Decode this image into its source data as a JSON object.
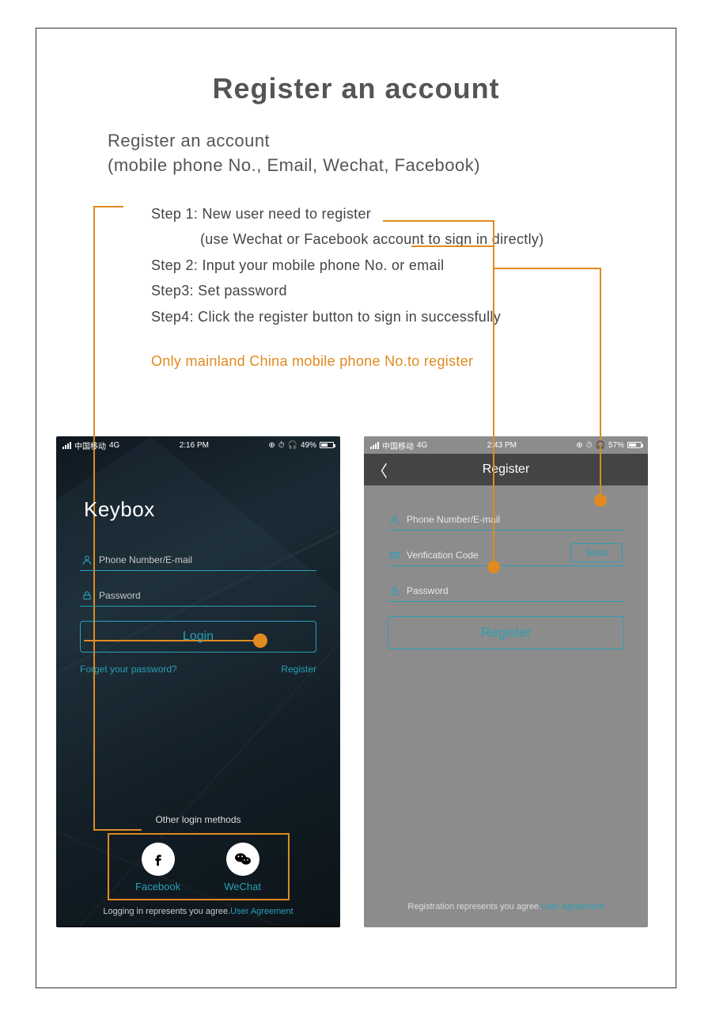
{
  "doc": {
    "title": "Register an account",
    "subtitle_line1": "Register an account",
    "subtitle_line2": "(mobile phone No., Email, Wechat, Facebook)",
    "step1a": "Step 1: New user need to register",
    "step1b": "(use Wechat or Facebook account to sign in directly)",
    "step2": "Step 2: Input your mobile phone No. or email",
    "step3": "Step3: Set password",
    "step4": "Step4: Click the register button to sign in successfully",
    "note": "Only mainland China mobile phone No.to register"
  },
  "login_screen": {
    "status": {
      "carrier": "中国移动",
      "network": "4G",
      "time": "2:16 PM",
      "battery_pct": "49%"
    },
    "app_name": "Keybox",
    "fields": {
      "phone_email": "Phone Number/E-mail",
      "password": "Password"
    },
    "login_btn": "Login",
    "forget_link": "Forget your password?",
    "register_link": "Register",
    "other_title": "Other login methods",
    "facebook": "Facebook",
    "wechat": "WeChat",
    "agree_pre": "Logging in represents you agree.",
    "agree_link": "User Agreement"
  },
  "register_screen": {
    "status": {
      "carrier": "中国移动",
      "network": "4G",
      "time": "2:43 PM",
      "battery_pct": "57%"
    },
    "header": "Register",
    "fields": {
      "phone_email": "Phone Number/E-mail",
      "code": "Verification Code",
      "password": "Password"
    },
    "send_btn": "Send",
    "register_btn": "Register",
    "agree_pre": "Registration represents you agree.",
    "agree_link": "User Agreement"
  }
}
